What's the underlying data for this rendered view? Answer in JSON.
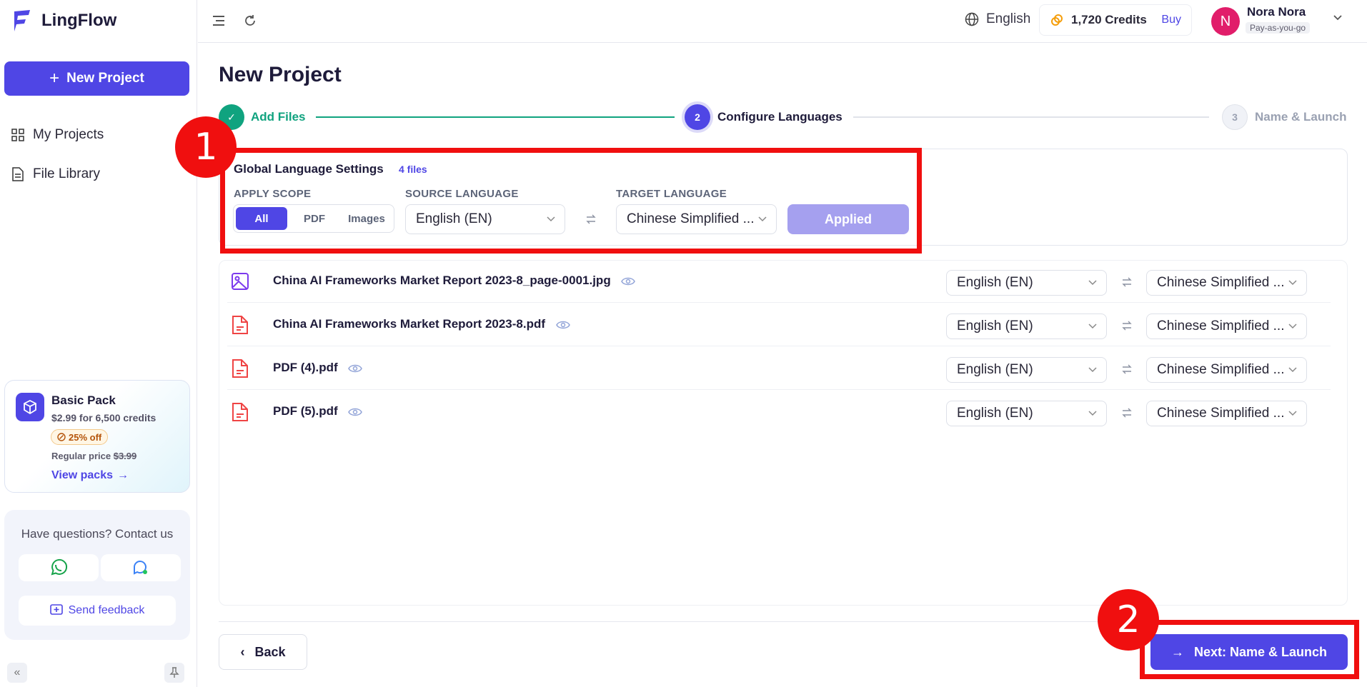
{
  "app": {
    "name": "LingFlow"
  },
  "sidebar": {
    "new_project": "New Project",
    "items": [
      {
        "label": "My Projects",
        "icon": "grid-icon"
      },
      {
        "label": "File Library",
        "icon": "document-icon"
      }
    ],
    "promo": {
      "title": "Basic Pack",
      "price": "$2.99 for 6,500 credits",
      "badge": "25% off",
      "regular_label": "Regular price",
      "regular_price": "$3.99",
      "link": "View packs"
    },
    "contact": {
      "title": "Have questions? Contact us",
      "feedback": "Send feedback"
    }
  },
  "header": {
    "language": "English",
    "credits": "1,720 Credits",
    "buy": "Buy",
    "user": {
      "initial": "N",
      "name": "Nora Nora",
      "plan": "Pay-as-you-go"
    }
  },
  "page": {
    "title": "New Project",
    "steps": [
      {
        "number": "✓",
        "label": "Add Files",
        "state": "done"
      },
      {
        "number": "2",
        "label": "Configure Languages",
        "state": "active"
      },
      {
        "number": "3",
        "label": "Name & Launch",
        "state": "pending"
      }
    ]
  },
  "global_settings": {
    "title": "Global Language Settings",
    "file_count": "4 files",
    "scope_label": "APPLY SCOPE",
    "scope_options": [
      "All",
      "PDF",
      "Images"
    ],
    "scope_selected": "All",
    "source_label": "SOURCE LANGUAGE",
    "source_value": "English (EN)",
    "target_label": "TARGET LANGUAGE",
    "target_value": "Chinese Simplified ...",
    "applied": "Applied"
  },
  "files": [
    {
      "name": "China AI Frameworks Market Report 2023-8_page-0001.jpg",
      "type": "image",
      "source": "English (EN)",
      "target": "Chinese Simplified ..."
    },
    {
      "name": "China AI Frameworks Market Report 2023-8.pdf",
      "type": "pdf",
      "source": "English (EN)",
      "target": "Chinese Simplified ..."
    },
    {
      "name": "PDF (4).pdf",
      "type": "pdf",
      "source": "English (EN)",
      "target": "Chinese Simplified ..."
    },
    {
      "name": "PDF (5).pdf",
      "type": "pdf",
      "source": "English (EN)",
      "target": "Chinese Simplified ..."
    }
  ],
  "footer": {
    "back": "Back",
    "next": "Next: Name & Launch"
  },
  "annotations": [
    "1",
    "2"
  ],
  "colors": {
    "accent": "#4f46e5",
    "success": "#10a37f",
    "annotation": "#f00f0f",
    "pdf": "#ef4444"
  }
}
